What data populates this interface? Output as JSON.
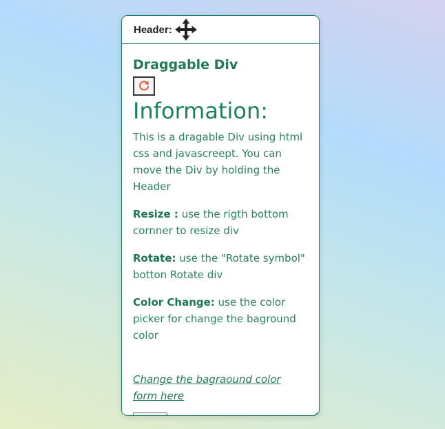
{
  "header": {
    "label": "Header:",
    "move_icon": "move-arrows-icon"
  },
  "content": {
    "title": "Draggable Div",
    "rotate_icon": "rotate-icon",
    "info_heading": "Information:",
    "intro": "This is a dragable Div using html css and javascreept. You can move the Div by holding the Header",
    "resize_label": "Resize :",
    "resize_text": " use the rigth bottom cornner to resize div",
    "rotate_label": "Rotate:",
    "rotate_text": " use the \"Rotate symbol\" botton Rotate div",
    "color_label": "Color Change:",
    "color_text": " use the color picker for change the baground color",
    "link_text": "Change the bagraound color form here",
    "color_value": "#ec1111"
  },
  "colors": {
    "accent": "#1e8259",
    "rotate_icon": "#e8533a"
  }
}
